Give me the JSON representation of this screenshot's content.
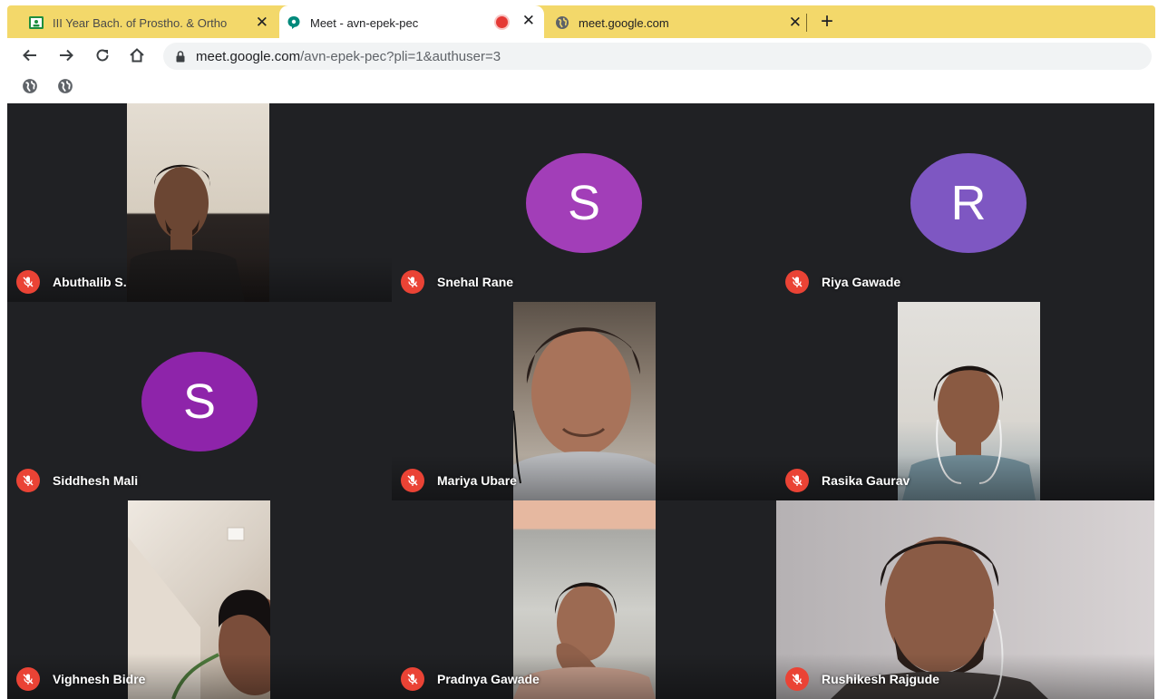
{
  "browser": {
    "tabs": [
      {
        "title": "III Year Bach. of Prostho. & Ortho",
        "icon": "classroom-icon",
        "active": false
      },
      {
        "title": "Meet - avn-epek-pec",
        "icon": "meet-icon",
        "active": true,
        "recording": true
      },
      {
        "title": "meet.google.com",
        "icon": "globe-icon",
        "active": false
      }
    ],
    "close_glyph": "✕",
    "new_tab_glyph": "+",
    "url_host": "meet.google.com",
    "url_path": "/avn-epek-pec?pli=1&authuser=3",
    "bookmarks": [
      {
        "icon": "globe-icon"
      },
      {
        "icon": "globe-icon"
      }
    ]
  },
  "meet": {
    "participants": [
      {
        "name": "Abuthalib S.",
        "muted": true,
        "type": "video"
      },
      {
        "name": "Snehal Rane",
        "muted": true,
        "type": "avatar",
        "initial": "S",
        "color": "#a23eb8"
      },
      {
        "name": "Riya Gawade",
        "muted": true,
        "type": "avatar",
        "initial": "R",
        "color": "#7e57c2"
      },
      {
        "name": "Siddhesh Mali",
        "muted": true,
        "type": "avatar",
        "initial": "S",
        "color": "#8e24aa"
      },
      {
        "name": "Mariya Ubare",
        "muted": true,
        "type": "video"
      },
      {
        "name": "Rasika Gaurav",
        "muted": true,
        "type": "video"
      },
      {
        "name": "Vighnesh Bidre",
        "muted": true,
        "type": "video"
      },
      {
        "name": "Pradnya Gawade",
        "muted": true,
        "type": "video"
      },
      {
        "name": "Rushikesh Rajgude",
        "muted": true,
        "type": "video"
      }
    ]
  },
  "colors": {
    "tabstrip": "#f3d86a",
    "meet_bg": "#202124",
    "mute_badge": "#ea4335"
  }
}
